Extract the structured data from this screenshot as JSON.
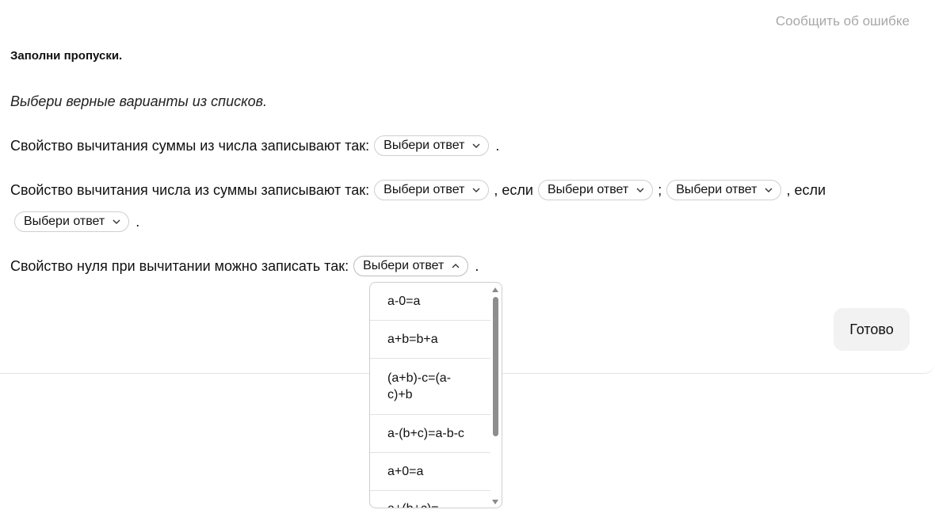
{
  "header": {
    "report_link": "Сообщить об ошибке"
  },
  "task": {
    "title": "Заполни пропуски.",
    "instruction": "Выбери верные варианты из списков."
  },
  "lines": {
    "line1": {
      "text": "Свойство вычитания суммы из числа записывают так:",
      "end": "."
    },
    "line2": {
      "text": "Свойство вычитания числа из суммы записывают так:",
      "if1": ", если",
      "sep": ";",
      "if2": ", если",
      "end": "."
    },
    "line3": {
      "text": "Свойство нуля при вычитании можно записать так:",
      "end": "."
    }
  },
  "select_placeholder": "Выбери ответ",
  "dropdown": {
    "options": [
      "a-0=a",
      "a+b=b+a",
      "(a+b)-c=(a-c)+b",
      "a-(b+c)=a-b-c",
      "a+0=a",
      "a+(b+c)="
    ]
  },
  "actions": {
    "done_label": "Готово"
  }
}
